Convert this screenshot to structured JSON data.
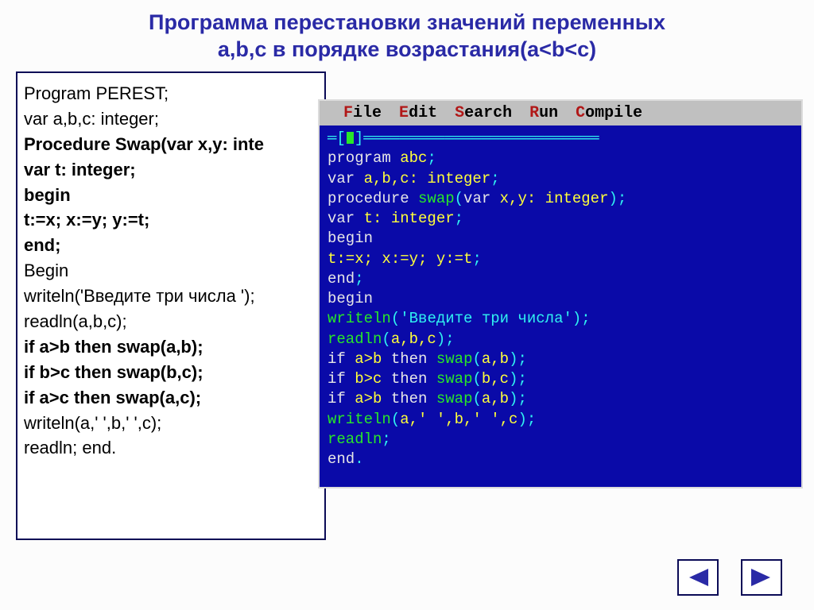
{
  "title_line1": "Программа перестановки значений переменных",
  "title_line2": "a,b,c в порядке возрастания(a<b<c)",
  "left_code": {
    "l1": "Program PEREST;",
    "l2": "var a,b,c: integer;",
    "l3": "Procedure Swap(var x,y: inte",
    "l4": "var t: integer;",
    "l5": "begin",
    "l6": "t:=x; x:=y; y:=t;",
    "l7": "end;",
    "l8": "Begin",
    "l9": "writeln('Введите три числа ');",
    "l10": "readln(a,b,c);",
    "l11": "if a>b then swap(a,b);",
    "l12": "if b>c then swap(b,c);",
    "l13": "if a>c then swap(a,c);",
    "l14": "writeln(a,' ',b,' ',c);",
    "l15": "readln;  end."
  },
  "ide": {
    "menu": {
      "file_hk": "F",
      "file_rest": "ile",
      "edit_hk": "E",
      "edit_rest": "dit",
      "search_hk": "S",
      "search_rest": "earch",
      "run_hk": "R",
      "run_rest": "un",
      "compile_hk": "C",
      "compile_rest": "ompile"
    },
    "code": {
      "l1": {
        "kw": "program ",
        "id": "abc",
        "sym": ";"
      },
      "l2": {
        "kw": "var ",
        "id": "a,b,c: integer",
        "sym": ";"
      },
      "l3": {
        "kw": "procedure ",
        "fn": "swap",
        "sym1": "(",
        "kw2": "var ",
        "id": "x,y: integer",
        "sym2": ");"
      },
      "l4": {
        "kw": "var ",
        "id": "t: integer",
        "sym": ";"
      },
      "l5": {
        "kw": "begin"
      },
      "l6": {
        "id": "t:=x; x:=y; y:=t",
        "sym": ";"
      },
      "l7": {
        "kw": "end",
        "sym": ";"
      },
      "l8": {
        "kw": "begin"
      },
      "l9": {
        "fn": "writeln",
        "sym1": "(",
        "str": "'Введите три числа'",
        "sym2": ");"
      },
      "l10": {
        "fn": "readln",
        "sym1": "(",
        "id": "a,b,c",
        "sym2": ");"
      },
      "l11": {
        "kw": "if ",
        "id": "a>b",
        "kw2": " then ",
        "fn": "swap",
        "sym1": "(",
        "id2": "a,b",
        "sym2": ");"
      },
      "l12": {
        "kw": "if ",
        "id": "b>c",
        "kw2": " then ",
        "fn": "swap",
        "sym1": "(",
        "id2": "b,c",
        "sym2": ");"
      },
      "l13": {
        "kw": "if ",
        "id": "a>b",
        "kw2": " then ",
        "fn": "swap",
        "sym1": "(",
        "id2": "a,b",
        "sym2": ");"
      },
      "l14": {
        "fn": "writeln",
        "sym1": "(",
        "id": "a,' ',b,' ',c",
        "sym2": ");"
      },
      "l15": {
        "fn": "readln",
        "sym": ";"
      },
      "l16": {
        "kw": "end",
        "sym": "."
      }
    }
  }
}
